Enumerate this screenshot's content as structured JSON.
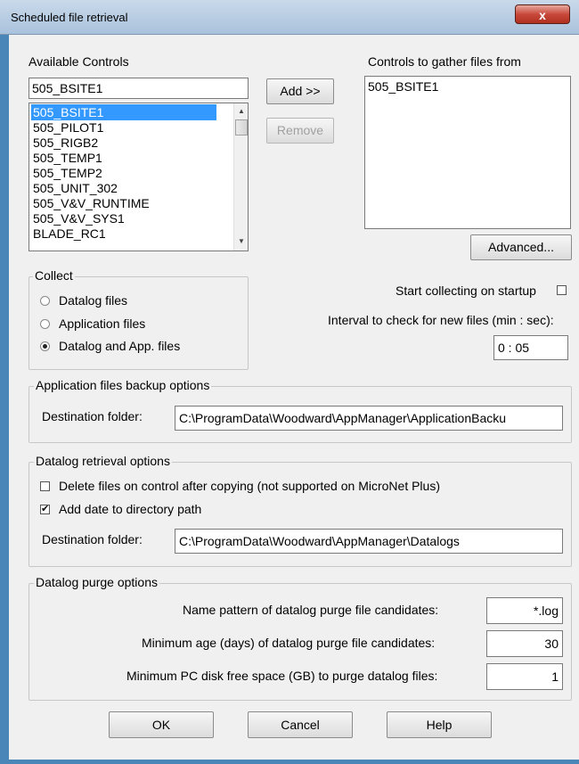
{
  "window": {
    "title": "Scheduled file retrieval",
    "close_label": "x"
  },
  "available": {
    "label": "Available Controls",
    "selected_value": "505_BSITE1",
    "items": [
      "505_BSITE1",
      "505_PILOT1",
      "505_RIGB2",
      "505_TEMP1",
      "505_TEMP2",
      "505_UNIT_302",
      "505_V&V_RUNTIME",
      "505_V&V_SYS1",
      "BLADE_RC1"
    ],
    "selected_index": 0
  },
  "buttons": {
    "add": "Add >>",
    "remove": "Remove",
    "advanced": "Advanced...",
    "ok": "OK",
    "cancel": "Cancel",
    "help": "Help"
  },
  "gather": {
    "label": "Controls to gather files from",
    "items": [
      "505_BSITE1"
    ]
  },
  "collect": {
    "title": "Collect",
    "options": [
      "Datalog files",
      "Application files",
      "Datalog and App. files"
    ],
    "selected_index": 2
  },
  "startup": {
    "label": "Start collecting on startup",
    "checked": false
  },
  "interval": {
    "label": "Interval to check for new files (min : sec):",
    "value": "0 : 05"
  },
  "app_backup": {
    "title": "Application files backup options",
    "dest_label": "Destination folder:",
    "dest_value": "C:\\ProgramData\\Woodward\\AppManager\\ApplicationBacku"
  },
  "datalog_retrieval": {
    "title": "Datalog retrieval options",
    "delete_label": "Delete files on control after copying (not supported on MicroNet Plus)",
    "delete_checked": false,
    "adddate_label": "Add date to directory path",
    "adddate_checked": true,
    "dest_label": "Destination folder:",
    "dest_value": "C:\\ProgramData\\Woodward\\AppManager\\Datalogs"
  },
  "purge": {
    "title": "Datalog purge options",
    "pattern_label": "Name pattern of datalog purge file candidates:",
    "pattern_value": "*.log",
    "age_label": "Minimum age (days) of datalog purge file candidates:",
    "age_value": "30",
    "space_label": "Minimum PC disk free space (GB) to purge datalog files:",
    "space_value": "1"
  },
  "icons": {
    "close": "close-icon",
    "scroll_up": "scroll-up-arrow-icon",
    "scroll_down": "scroll-down-arrow-icon",
    "check": "checkmark-icon"
  }
}
